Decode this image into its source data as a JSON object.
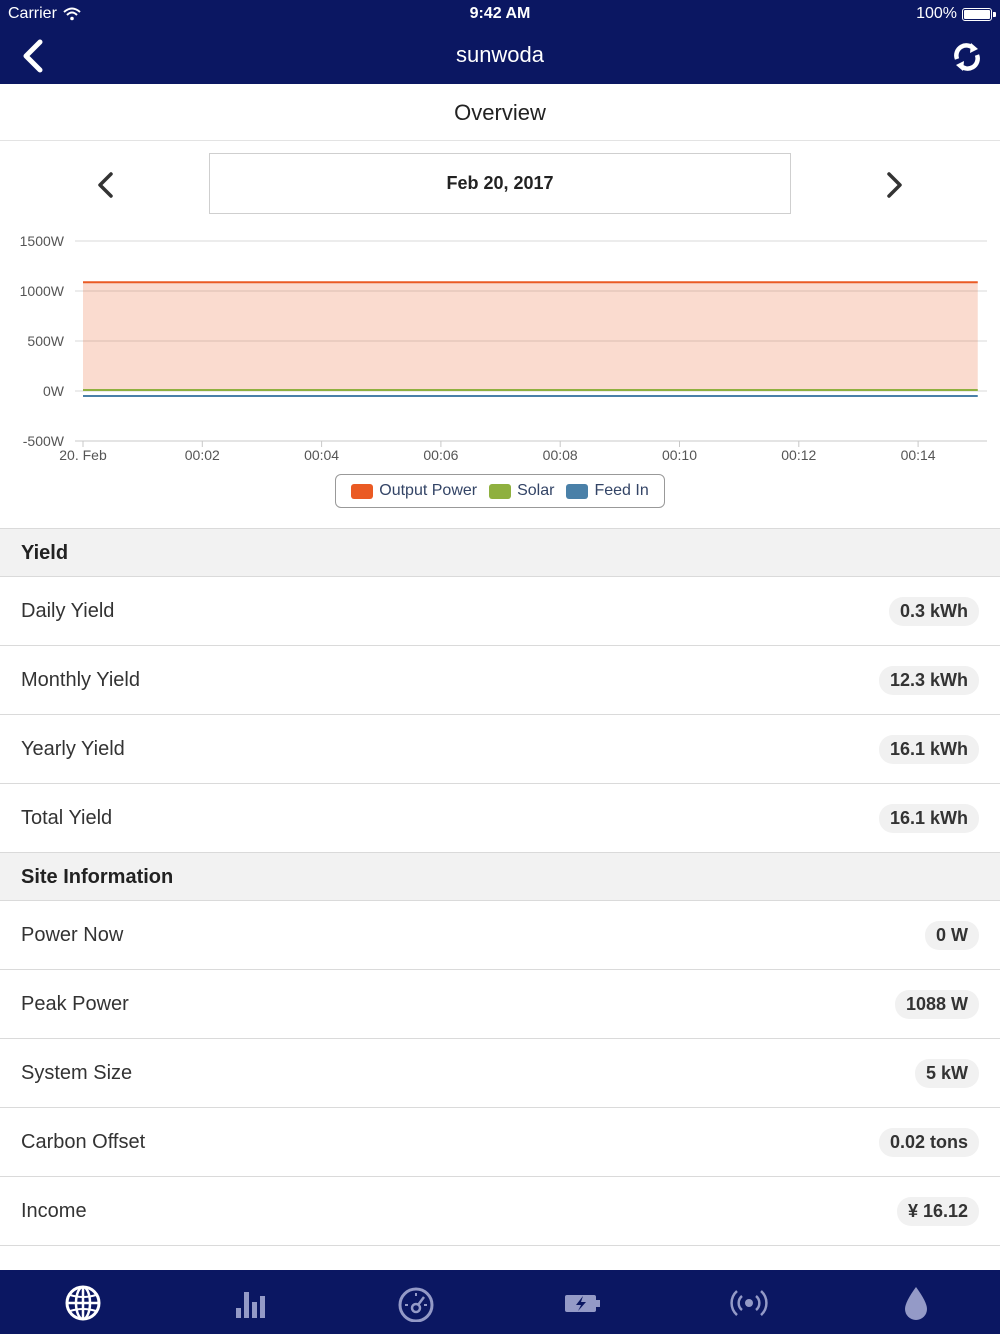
{
  "status_bar": {
    "carrier": "Carrier",
    "time": "9:42 AM",
    "battery": "100%"
  },
  "nav": {
    "title": "sunwoda",
    "back_icon": "chevron-left-icon",
    "refresh_icon": "refresh-icon"
  },
  "page": {
    "subtitle": "Overview"
  },
  "date_picker": {
    "date": "Feb 20, 2017",
    "prev_icon": "chevron-left-icon",
    "next_icon": "chevron-right-icon"
  },
  "chart_data": {
    "type": "area",
    "title": "",
    "xlabel": "",
    "ylabel": "",
    "x_ticks": [
      "20. Feb",
      "00:02",
      "00:04",
      "00:06",
      "00:08",
      "00:10",
      "00:12",
      "00:14"
    ],
    "y_ticks": [
      "1500W",
      "1000W",
      "500W",
      "0W",
      "-500W"
    ],
    "ylim": [
      -500,
      1500
    ],
    "grid": true,
    "legend_position": "bottom-center",
    "series": [
      {
        "name": "Output Power",
        "color": "#ea5a23",
        "x": [
          "00:00",
          "00:15"
        ],
        "values": [
          1088,
          1088
        ]
      },
      {
        "name": "Solar",
        "color": "#8fb03f",
        "x": [
          "00:00",
          "00:15"
        ],
        "values": [
          10,
          10
        ]
      },
      {
        "name": "Feed In",
        "color": "#4a80a8",
        "x": [
          "00:00",
          "00:15"
        ],
        "values": [
          -50,
          -50
        ]
      }
    ]
  },
  "yield_section": {
    "title": "Yield",
    "rows": [
      {
        "label": "Daily Yield",
        "value": "0.3 kWh"
      },
      {
        "label": "Monthly Yield",
        "value": "12.3 kWh"
      },
      {
        "label": "Yearly Yield",
        "value": "16.1 kWh"
      },
      {
        "label": "Total Yield",
        "value": "16.1 kWh"
      }
    ]
  },
  "site_section": {
    "title": "Site Information",
    "rows": [
      {
        "label": "Power Now",
        "value": "0 W"
      },
      {
        "label": "Peak Power",
        "value": "1088 W"
      },
      {
        "label": "System Size",
        "value": "5 kW"
      },
      {
        "label": "Carbon Offset",
        "value": "0.02 tons"
      },
      {
        "label": "Income",
        "value": "¥ 16.12"
      }
    ]
  },
  "tab_bar": {
    "tabs": [
      {
        "icon": "globe-icon"
      },
      {
        "icon": "bar-chart-icon"
      },
      {
        "icon": "speedometer-icon"
      },
      {
        "icon": "battery-charging-icon"
      },
      {
        "icon": "broadcast-icon"
      },
      {
        "icon": "water-drop-icon"
      }
    ]
  }
}
